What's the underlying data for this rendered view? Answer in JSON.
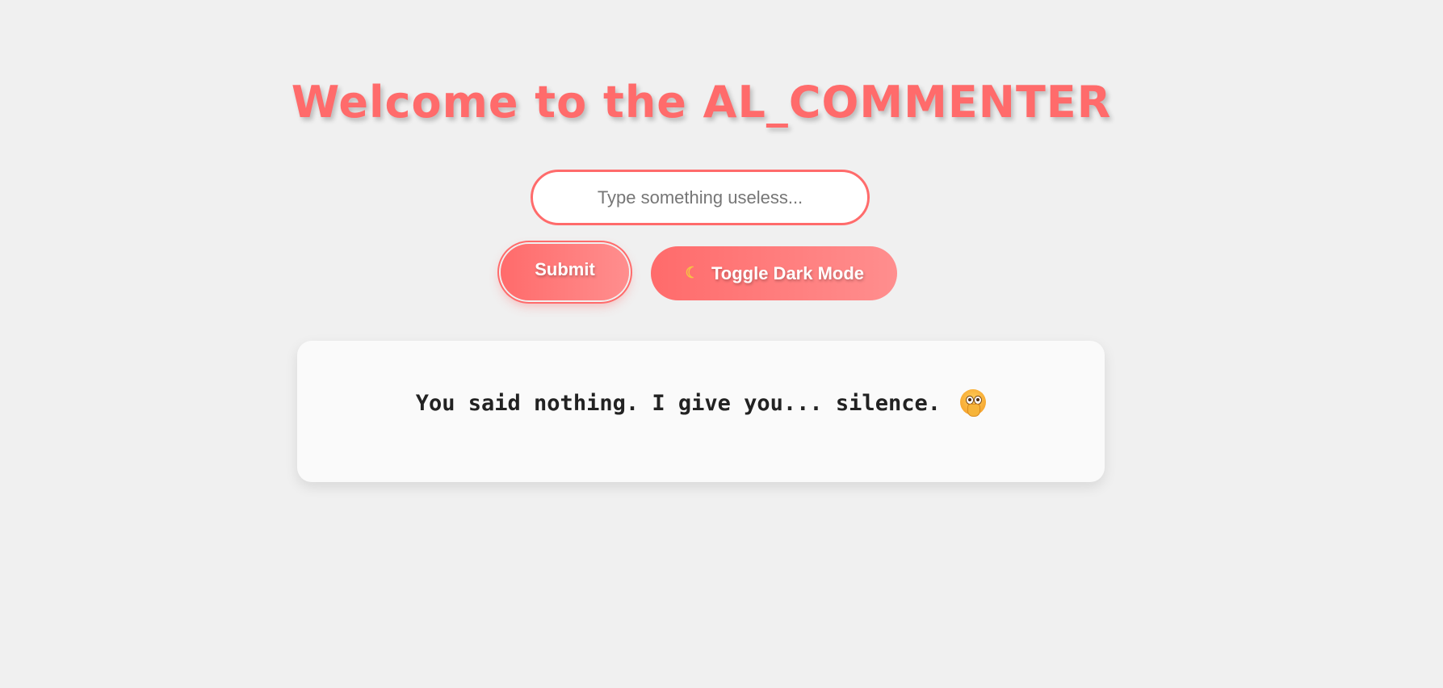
{
  "header": {
    "title": "Welcome to the AL_COMMENTER"
  },
  "input": {
    "placeholder": "Type something useless...",
    "value": ""
  },
  "buttons": {
    "submit_label": "Submit",
    "toggle_label": "Toggle Dark Mode",
    "toggle_icon": "moon-icon"
  },
  "response": {
    "text": "You said nothing. I give you... silence.",
    "icon": "shushing-face-icon"
  },
  "colors": {
    "accent": "#ff6b6b",
    "accent_light": "#ff8e8e",
    "background": "#f0f0f0",
    "card_background": "#fafafa"
  }
}
